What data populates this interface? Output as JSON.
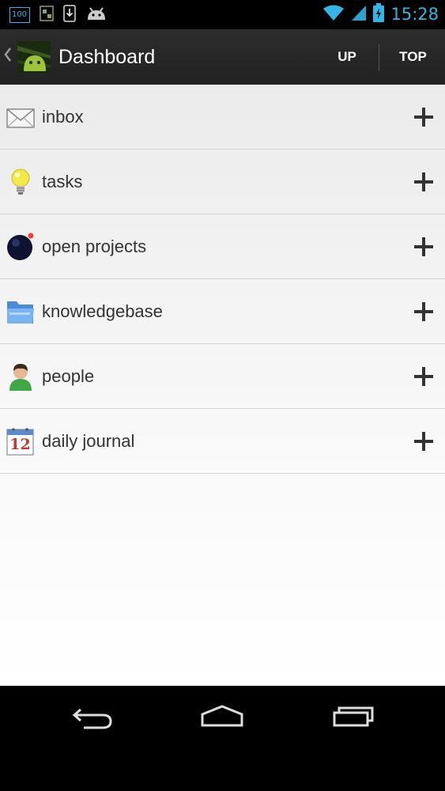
{
  "status_bar": {
    "battery_badge": "100",
    "clock": "15:28",
    "icons": [
      "battery-100-notification-icon",
      "sim-notification-icon",
      "download-notification-icon",
      "android-notification-icon",
      "wifi-icon",
      "signal-icon",
      "battery-icon"
    ]
  },
  "action_bar": {
    "title": "Dashboard",
    "up_label": "UP",
    "top_label": "TOP"
  },
  "items": [
    {
      "label": "inbox",
      "icon": "envelope-icon"
    },
    {
      "label": "tasks",
      "icon": "lightbulb-icon"
    },
    {
      "label": "open projects",
      "icon": "bomb-icon"
    },
    {
      "label": "knowledgebase",
      "icon": "folder-icon"
    },
    {
      "label": "people",
      "icon": "person-icon"
    },
    {
      "label": "daily journal",
      "icon": "calendar-icon",
      "calendar_day": "12"
    }
  ],
  "colors": {
    "status_accent": "#33b5e5",
    "action_bar": "#262626",
    "content_bg": "#f2f2f2",
    "label_text": "#333333"
  }
}
